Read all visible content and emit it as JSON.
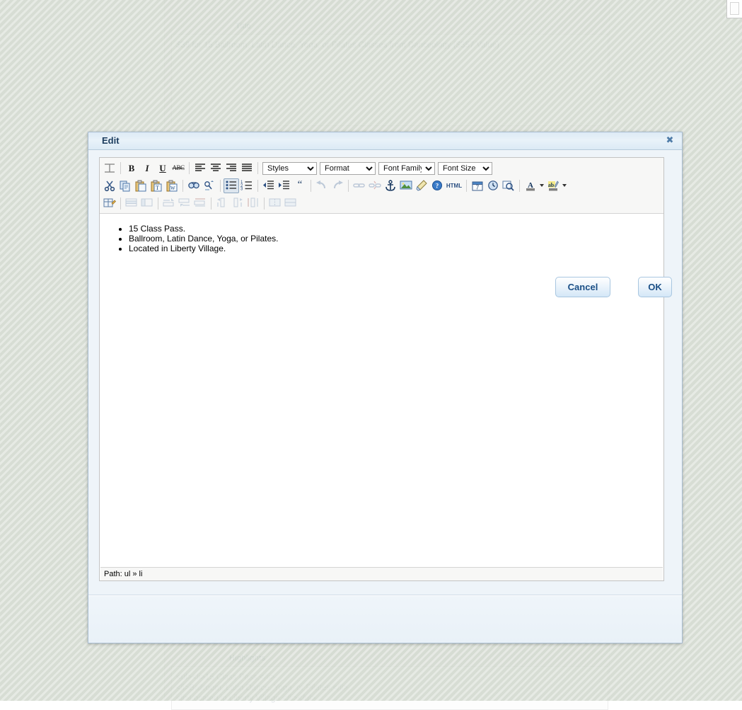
{
  "background_page": {
    "fields": [
      {
        "label": "Title",
        "value": "$39 for 15 Ballroom, Latin Dance, Yoga, or Pilates Classes from Danceology ($357 Value)"
      },
      {
        "label": "Highlights",
        "value": "<ul><li>15 Class Pass.</li>\n<li>Ballroom, Latin Dance, Yoga, or Pilates.</li>\n<li>Located in Liberty Village.</li></ul>"
      }
    ]
  },
  "dialog": {
    "title": "Edit",
    "close_label": "✖",
    "close_icon": "close-icon",
    "buttons": {
      "cancel": "Cancel",
      "ok": "OK"
    },
    "statusbar": {
      "path_label": "Path: ul » li"
    },
    "editor": {
      "toolbar_rows": [
        {
          "name": "row-1",
          "items": [
            {
              "icon": "toggle-toolbar-icon",
              "label": "Toggle toolbars",
              "state": "enabled"
            },
            {
              "icon": "separator",
              "label": "",
              "state": "static"
            },
            {
              "icon": "bold-icon",
              "label": "B",
              "state": "enabled"
            },
            {
              "icon": "italic-icon",
              "label": "I",
              "state": "enabled"
            },
            {
              "icon": "underline-icon",
              "label": "U",
              "state": "enabled"
            },
            {
              "icon": "strikethrough-icon",
              "label": "ABC",
              "state": "enabled"
            },
            {
              "icon": "separator",
              "label": "",
              "state": "static"
            },
            {
              "icon": "align-left-icon",
              "label": "Align left",
              "state": "enabled"
            },
            {
              "icon": "align-center-icon",
              "label": "Align center",
              "state": "enabled"
            },
            {
              "icon": "align-right-icon",
              "label": "Align right",
              "state": "enabled"
            },
            {
              "icon": "align-justify-icon",
              "label": "Align full",
              "state": "enabled"
            }
          ]
        },
        {
          "name": "row-2",
          "items": [
            {
              "icon": "cut-icon",
              "label": "Cut",
              "state": "enabled"
            },
            {
              "icon": "copy-icon",
              "label": "Copy",
              "state": "enabled"
            },
            {
              "icon": "paste-icon",
              "label": "Paste",
              "state": "enabled"
            },
            {
              "icon": "paste-text-icon",
              "label": "Paste as plain text",
              "state": "enabled"
            },
            {
              "icon": "paste-word-icon",
              "label": "Paste from Word",
              "state": "enabled"
            },
            {
              "icon": "separator",
              "label": "",
              "state": "static"
            },
            {
              "icon": "search-icon",
              "label": "Find",
              "state": "enabled"
            },
            {
              "icon": "search-replace-icon",
              "label": "Find/Replace",
              "state": "enabled"
            },
            {
              "icon": "separator",
              "label": "",
              "state": "static"
            },
            {
              "icon": "bullet-list-icon",
              "label": "Unordered list",
              "state": "active"
            },
            {
              "icon": "numbered-list-icon",
              "label": "Ordered list",
              "state": "enabled"
            },
            {
              "icon": "separator",
              "label": "",
              "state": "static"
            },
            {
              "icon": "outdent-icon",
              "label": "Outdent",
              "state": "enabled"
            },
            {
              "icon": "indent-icon",
              "label": "Indent",
              "state": "enabled"
            },
            {
              "icon": "blockquote-icon",
              "label": "Blockquote",
              "state": "enabled"
            },
            {
              "icon": "separator",
              "label": "",
              "state": "static"
            },
            {
              "icon": "undo-icon",
              "label": "Undo",
              "state": "disabled"
            },
            {
              "icon": "redo-icon",
              "label": "Redo",
              "state": "disabled"
            },
            {
              "icon": "separator",
              "label": "",
              "state": "static"
            },
            {
              "icon": "link-icon",
              "label": "Insert link",
              "state": "disabled"
            },
            {
              "icon": "unlink-icon",
              "label": "Unlink",
              "state": "disabled"
            },
            {
              "icon": "anchor-icon",
              "label": "Insert anchor",
              "state": "enabled"
            },
            {
              "icon": "image-icon",
              "label": "Insert image",
              "state": "enabled"
            },
            {
              "icon": "cleanup-icon",
              "label": "Cleanup messy code",
              "state": "enabled"
            },
            {
              "icon": "help-icon",
              "label": "Help",
              "state": "enabled"
            },
            {
              "icon": "html-source-icon",
              "label": "HTML",
              "state": "enabled"
            },
            {
              "icon": "separator",
              "label": "",
              "state": "static"
            },
            {
              "icon": "insert-date-icon",
              "label": "Insert date",
              "state": "enabled"
            },
            {
              "icon": "insert-time-icon",
              "label": "Insert time",
              "state": "enabled"
            },
            {
              "icon": "preview-icon",
              "label": "Preview",
              "state": "enabled"
            },
            {
              "icon": "separator",
              "label": "",
              "state": "static"
            },
            {
              "icon": "text-color-icon",
              "label": "Select text color",
              "state": "enabled"
            },
            {
              "icon": "dropdown-arrow-icon",
              "label": "",
              "state": "enabled"
            },
            {
              "icon": "background-color-icon",
              "label": "Select background color",
              "state": "enabled"
            },
            {
              "icon": "dropdown-arrow-icon",
              "label": "",
              "state": "enabled"
            }
          ]
        },
        {
          "name": "row-3",
          "items": [
            {
              "icon": "table-properties-icon",
              "label": "Table properties",
              "state": "enabled"
            },
            {
              "icon": "separator",
              "label": "",
              "state": "static"
            },
            {
              "icon": "row-properties-icon",
              "label": "Table row properties",
              "state": "disabled"
            },
            {
              "icon": "cell-properties-icon",
              "label": "Table cell properties",
              "state": "disabled"
            },
            {
              "icon": "separator",
              "label": "",
              "state": "static"
            },
            {
              "icon": "row-before-icon",
              "label": "Insert row before",
              "state": "disabled"
            },
            {
              "icon": "row-after-icon",
              "label": "Insert row after",
              "state": "disabled"
            },
            {
              "icon": "delete-row-icon",
              "label": "Delete row",
              "state": "disabled"
            },
            {
              "icon": "separator",
              "label": "",
              "state": "static"
            },
            {
              "icon": "col-before-icon",
              "label": "Insert column before",
              "state": "disabled"
            },
            {
              "icon": "col-after-icon",
              "label": "Insert column after",
              "state": "disabled"
            },
            {
              "icon": "delete-col-icon",
              "label": "Delete column",
              "state": "disabled"
            },
            {
              "icon": "separator",
              "label": "",
              "state": "static"
            },
            {
              "icon": "split-cells-icon",
              "label": "Split merged cells",
              "state": "disabled"
            },
            {
              "icon": "merge-cells-icon",
              "label": "Merge table cells",
              "state": "disabled"
            }
          ]
        }
      ],
      "selects": [
        {
          "name": "styles",
          "value": "Styles",
          "options": [
            "Styles"
          ]
        },
        {
          "name": "format",
          "value": "Format",
          "options": [
            "Format"
          ]
        },
        {
          "name": "font_family",
          "value": "Font Family",
          "options": [
            "Font Family"
          ]
        },
        {
          "name": "font_size",
          "value": "Font Size",
          "options": [
            "Font Size"
          ]
        }
      ],
      "content_list": [
        "15 Class Pass.",
        "Ballroom, Latin Dance, Yoga, or Pilates.",
        "Located in Liberty Village."
      ]
    }
  },
  "colors": {
    "dialog_border": "#a9bdd0",
    "titlebar": "#e3eef7",
    "title_text": "#1b3c5e",
    "button_text": "#1b4f86",
    "backdrop": "#cdd4c9",
    "toolbar_bg": "#f7f7f6",
    "active_button_bg": "#dde6ef"
  }
}
